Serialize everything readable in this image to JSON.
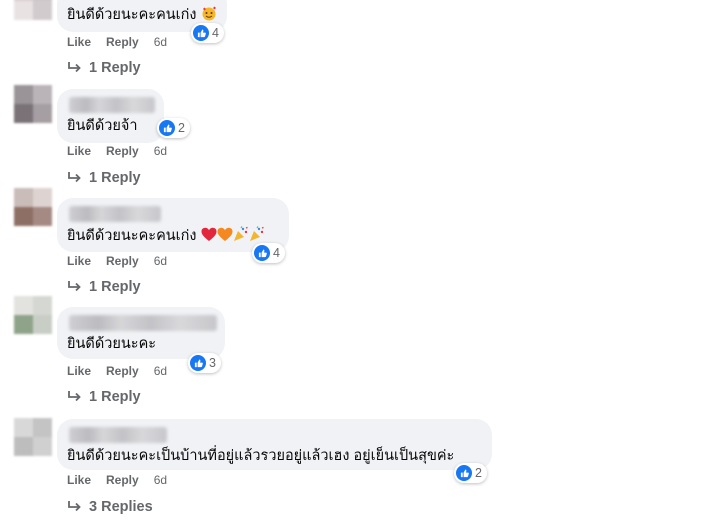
{
  "comments": [
    {
      "text": "ยินดีด้วยนะคะคนเก่ง",
      "reactions": "4",
      "like": "Like",
      "reply": "Reply",
      "time": "6d",
      "replies": "1 Reply"
    },
    {
      "text": "ยินดีด้วยจ้า",
      "reactions": "2",
      "like": "Like",
      "reply": "Reply",
      "time": "6d",
      "replies": "1 Reply"
    },
    {
      "text": "ยินดีด้วยนะคะคนเก่ง",
      "reactions": "4",
      "like": "Like",
      "reply": "Reply",
      "time": "6d",
      "replies": "1 Reply"
    },
    {
      "text": "ยินดีด้วยนะคะ",
      "reactions": "3",
      "like": "Like",
      "reply": "Reply",
      "time": "6d",
      "replies": "1 Reply"
    },
    {
      "text": "ยินดีด้วยนะคะเป็นบ้านที่อยู่แล้วรวยอยู่แล้วเฮง อยู่เย็นเป็นสุขค่ะ",
      "reactions": "2",
      "like": "Like",
      "reply": "Reply",
      "time": "6d",
      "replies": "3 Replies"
    }
  ],
  "colors": {
    "bubble": "#f0f2f5",
    "like_blue": "#1877f2",
    "meta_gray": "#65676b"
  },
  "icons": {
    "reaction": "like-icon",
    "reply_arrow": "reply-arrow-icon"
  }
}
